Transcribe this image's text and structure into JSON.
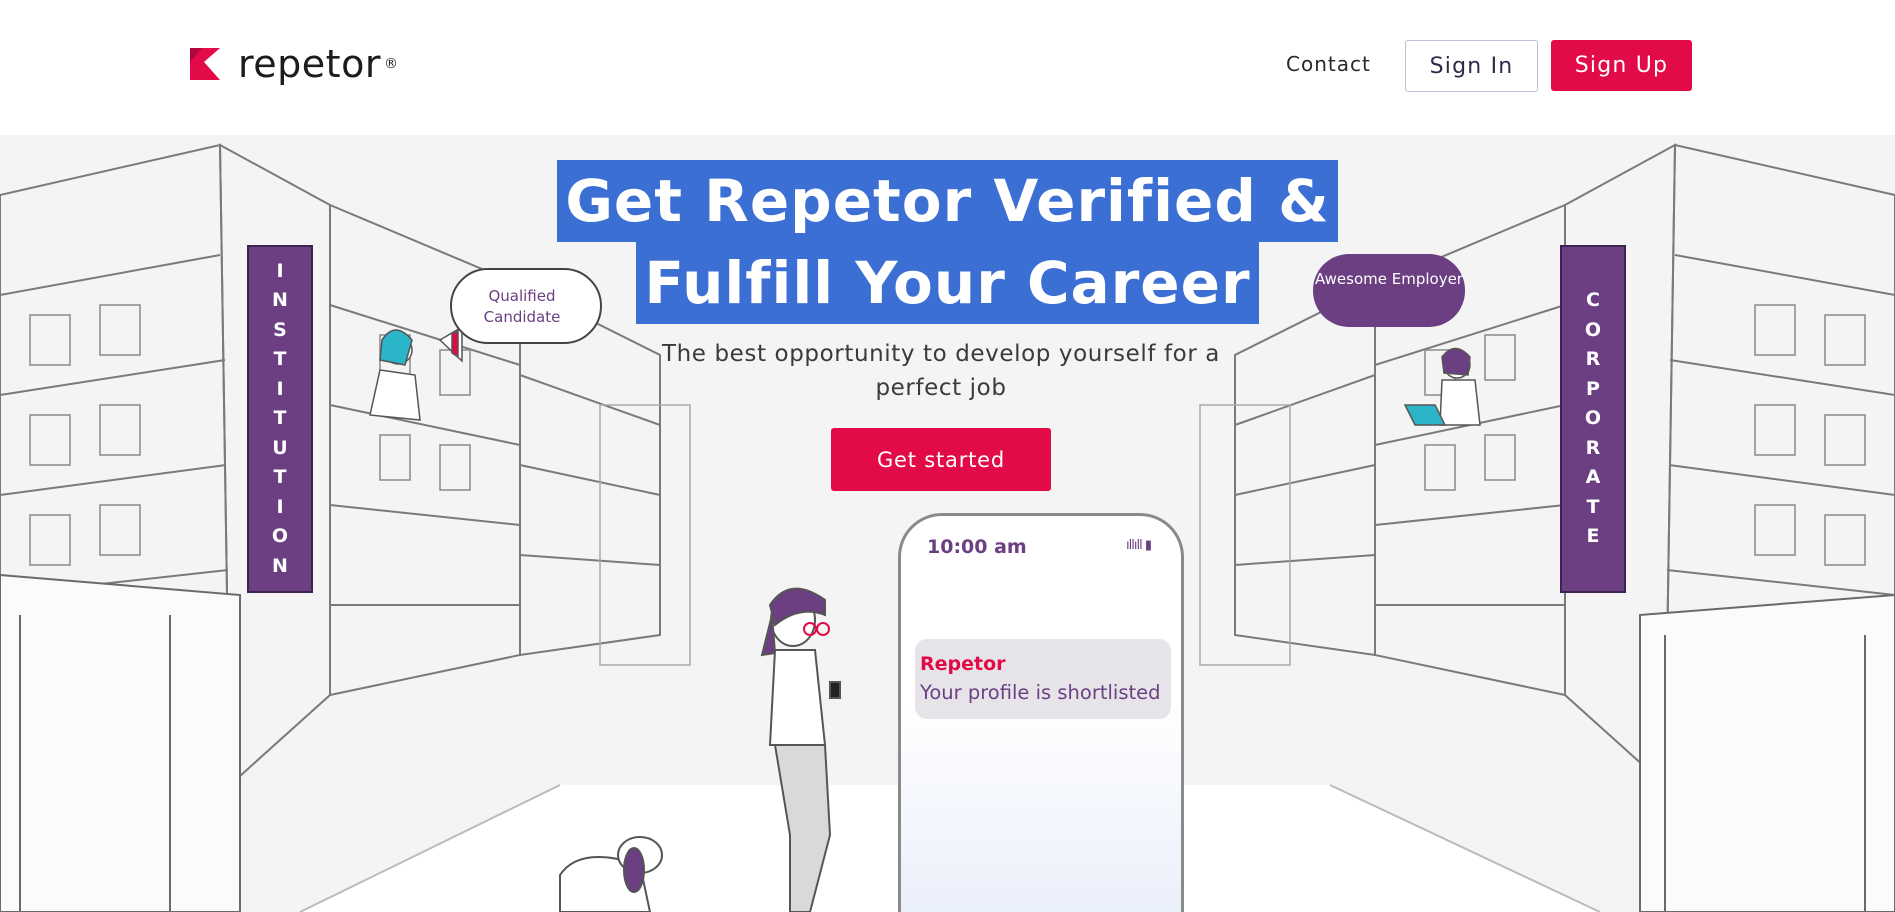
{
  "header": {
    "logo_text": "repetor",
    "logo_reg": "®",
    "nav": {
      "contact": "Contact"
    },
    "buttons": {
      "sign_in": "Sign In",
      "sign_up": "Sign Up"
    }
  },
  "hero": {
    "headline_line1": "Get Repetor Verified &",
    "headline_line2": "Fulfill Your Career",
    "subtitle": "The best opportunity to develop yourself for a perfect job",
    "cta": "Get started",
    "left_sign_letters": [
      "I",
      "N",
      "S",
      "T",
      "I",
      "T",
      "U",
      "T",
      "I",
      "O",
      "N"
    ],
    "right_sign_letters": [
      "C",
      "O",
      "R",
      "P",
      "O",
      "R",
      "A",
      "T",
      "E"
    ],
    "bubble_left": "Qualified Candidate",
    "bubble_right": "Awesome Employer",
    "phone": {
      "time": "10:00 am",
      "status_icons": "ıllıll ▮",
      "notification_app": "Repetor",
      "notification_message": "Your profile is shortlisted"
    }
  },
  "colors": {
    "brand_red": "#e20b47",
    "brand_purple": "#6b3f82",
    "selection_blue": "#3b6fd4"
  }
}
